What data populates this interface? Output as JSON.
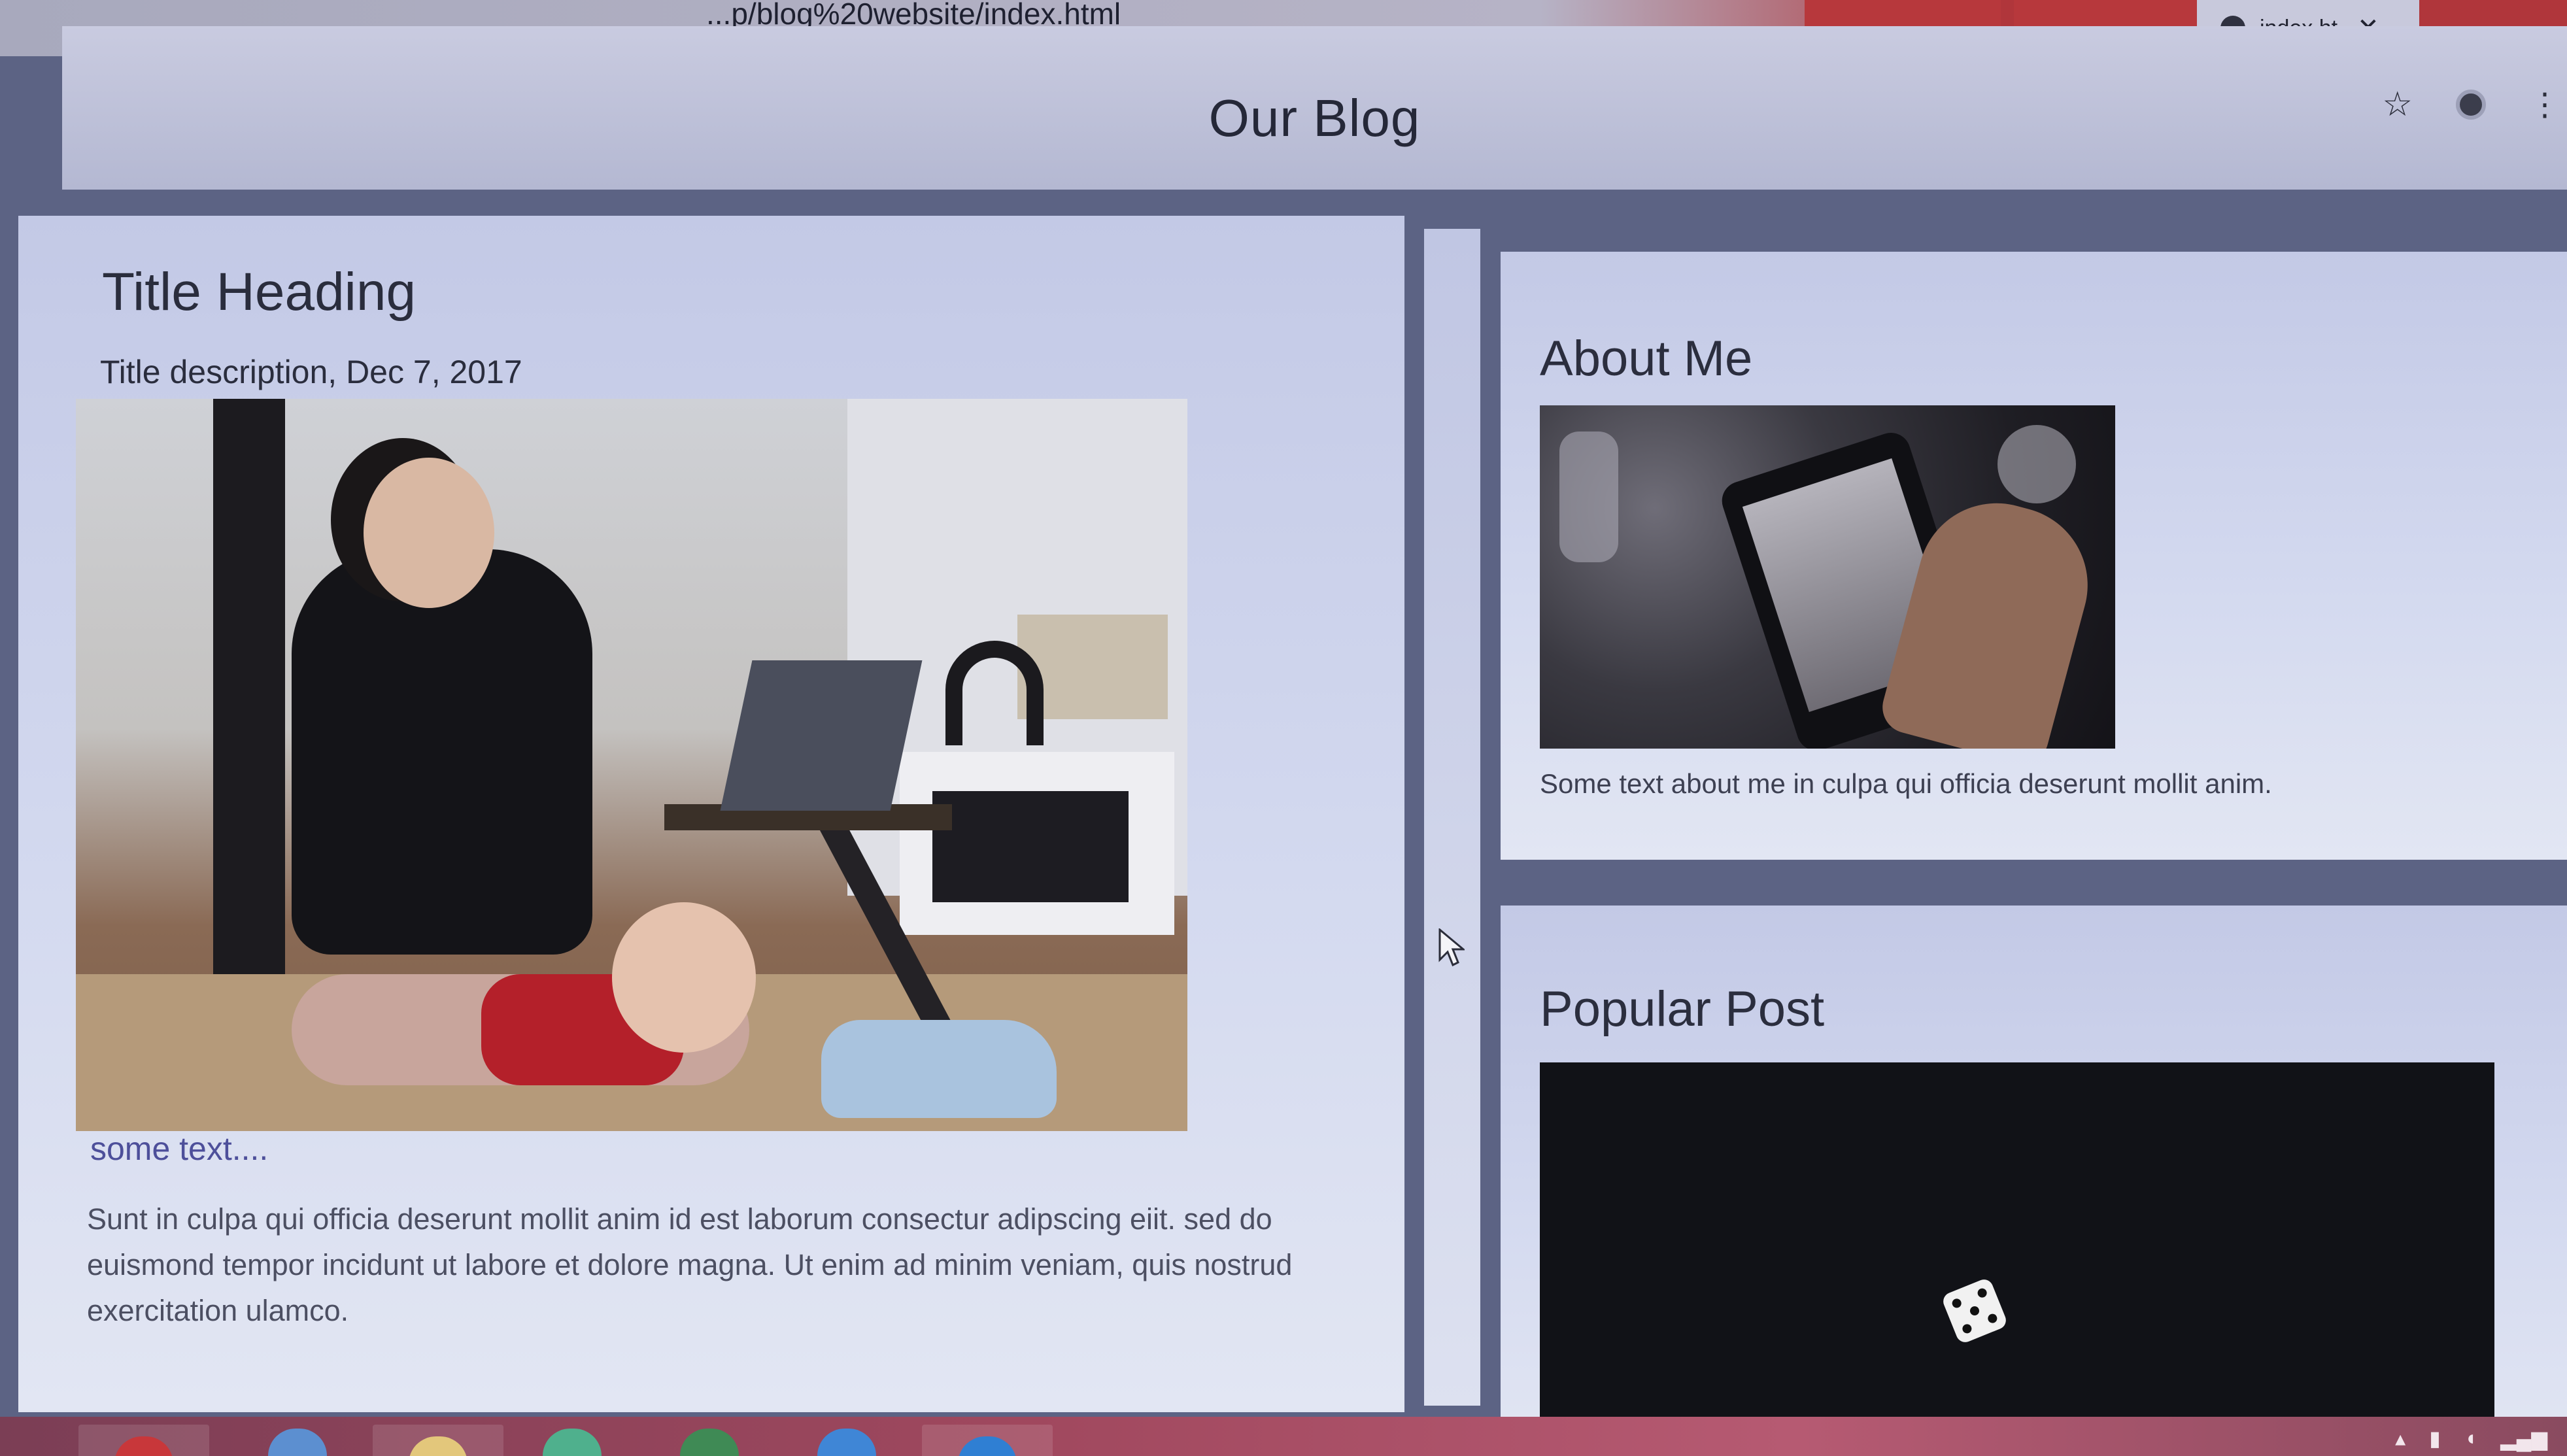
{
  "browser": {
    "address": "...p/blog%20website/index.html",
    "active_tab_label": "index.ht",
    "close_glyph": "✕",
    "star_glyph": "☆",
    "more_glyph": "⋮"
  },
  "site": {
    "title": "Our Blog"
  },
  "post": {
    "title": "Title Heading",
    "meta": "Title description, Dec 7, 2017",
    "image_icon": "photo-woman-laptop-baby",
    "link_text": "some text....",
    "body": "Sunt in culpa qui officia deserunt mollit anim id est laborum consectur adipscing eiit. sed do euismond tempor incidunt ut labore et dolore magna. Ut enim ad minim veniam, quis nostrud exercitation ulamco."
  },
  "about": {
    "title": "About Me",
    "image_icon": "photo-phone-selfie",
    "text": "Some text about me in culpa qui officia deserunt mollit anim."
  },
  "popular": {
    "title": "Popular Post",
    "image_icon": "dice-icon"
  },
  "colors": {
    "page_background": "#5c6384",
    "card_background": "#d3d9ef",
    "link": "#4d4f9a",
    "tab_strip_red": "#b0363b"
  }
}
